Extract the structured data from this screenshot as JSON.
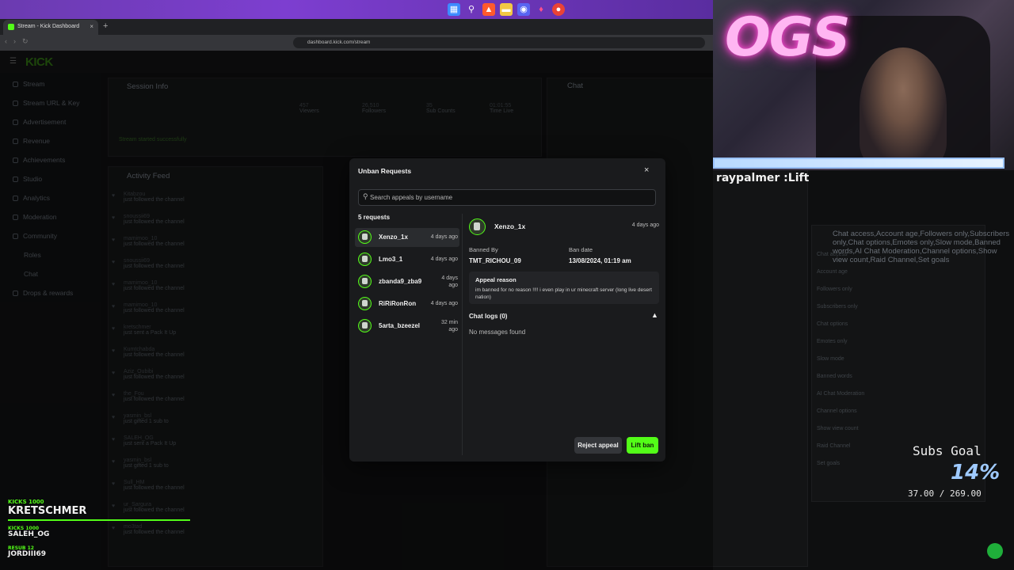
{
  "browser": {
    "tab_title": "Stream - Kick Dashboard",
    "tab_close": "×",
    "new_tab": "+",
    "url": "dashboard.kick.com/stream"
  },
  "kick": {
    "logo": "KICK"
  },
  "sidebar": {
    "items": [
      {
        "label": "Stream"
      },
      {
        "label": "Stream URL & Key"
      },
      {
        "label": "Advertisement"
      },
      {
        "label": "Revenue"
      },
      {
        "label": "Achievements"
      },
      {
        "label": "Studio"
      },
      {
        "label": "Analytics"
      },
      {
        "label": "Moderation"
      },
      {
        "label": "Community"
      },
      {
        "label": "Roles"
      },
      {
        "label": "Chat"
      },
      {
        "label": "Drops & rewards"
      }
    ]
  },
  "background": {
    "session_info": "Session Info",
    "activity_feed": "Activity Feed",
    "chat": "Chat",
    "channel_actions": [
      "Chat access",
      "Account age",
      "Followers only",
      "Subscribers only",
      "Chat options",
      "Emotes only",
      "Slow mode",
      "Banned words",
      "AI Chat Moderation",
      "Channel options",
      "Show view count",
      "Raid Channel",
      "Set goals"
    ],
    "stream_status": "Stream started successfully",
    "stats": [
      {
        "value": "457",
        "label": "Viewers"
      },
      {
        "value": "26,510",
        "label": "Followers"
      },
      {
        "value": "35",
        "label": "Sub Counts"
      },
      {
        "value": "01:01:55",
        "label": "Time Live"
      }
    ],
    "feed": [
      {
        "name": "Kitabzou",
        "sub": "just followed the channel"
      },
      {
        "name": "snoussii69",
        "sub": "just followed the channel"
      },
      {
        "name": "mamimoo_10",
        "sub": "just followed the channel"
      },
      {
        "name": "snoussii69",
        "sub": "just followed the channel"
      },
      {
        "name": "mamimoo_10",
        "sub": "just followed the channel"
      },
      {
        "name": "mamimoo_10",
        "sub": "just followed the channel"
      },
      {
        "name": "kretschmer",
        "sub": "just sent a Pack It Up"
      },
      {
        "name": "Kumtchabda",
        "sub": "just followed the channel"
      },
      {
        "name": "Aziz_Oubibi",
        "sub": "just followed the channel"
      },
      {
        "name": "the_Fou",
        "sub": "just followed the channel"
      },
      {
        "name": "yasmin_bsl",
        "sub": "just gifted 1 sub to"
      },
      {
        "name": "SALEH_OG",
        "sub": "just sent a Pack It Up"
      },
      {
        "name": "yasmin_bsl",
        "sub": "just gifted 1 sub to"
      },
      {
        "name": "Sull_HM",
        "sub": "just followed the channel"
      },
      {
        "name": "ur_Sargura",
        "sub": "just followed the channel"
      },
      {
        "name": "mo3tad",
        "sub": "just followed the channel"
      }
    ]
  },
  "modal": {
    "title": "Unban Requests",
    "close": "×",
    "search_placeholder": "Search appeals by username",
    "count": "5 requests",
    "requests": [
      {
        "name": "Xenzo_1x",
        "time": "4 days ago"
      },
      {
        "name": "Lmo3_1",
        "time": "4 days ago"
      },
      {
        "name": "zbanda9_zba9",
        "time": "4 days ago"
      },
      {
        "name": "RiRiRonRon",
        "time": "4 days ago"
      },
      {
        "name": "5arta_bzeezel",
        "time": "32 min ago"
      }
    ],
    "detail": {
      "username": "Xenzo_1x",
      "time": "4 days ago",
      "banned_by_label": "Banned By",
      "banned_by": "TMT_RICHOU_09",
      "ban_date_label": "Ban date",
      "ban_date": "13/08/2024, 01:19 am",
      "appeal_label": "Appeal reason",
      "appeal_text": "im banned for no reason !!!! i even play in ur minecraft server (long live desert nation)",
      "chat_logs": "Chat logs (0)",
      "no_messages": "No messages found"
    },
    "reject_label": "Reject appeal",
    "lift_label": "Lift ban"
  },
  "overlay": {
    "neon_sign": "OGS",
    "streamer_label": "raypalmer :Lift",
    "subs_goal_label": "Subs Goal",
    "subs_goal_pct": "14%",
    "subs_goal_amount": "37.00 / 269.00",
    "kicks": [
      {
        "head": "KICKS 1000",
        "name": "KRETSCHMER"
      },
      {
        "head": "KICKS 1000",
        "name": "SALEH_OG"
      },
      {
        "head": "RESUB 12",
        "name": "JORDIII69"
      }
    ]
  },
  "colors": {
    "accent": "#53fc18",
    "modal_bg": "#1a1b1d",
    "browser_purple": "#6b3bb0"
  }
}
